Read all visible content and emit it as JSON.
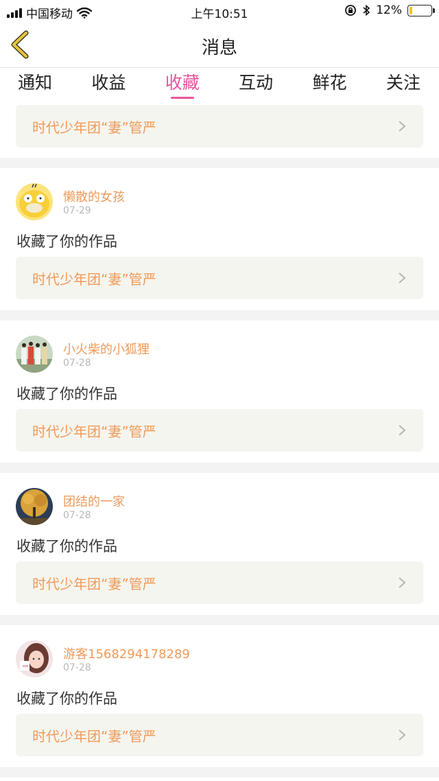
{
  "status_bar": {
    "carrier": "中国移动",
    "time": "上午10:51",
    "battery": "12%",
    "battery_level": 0.12,
    "icons": [
      "signal-icon",
      "wifi-icon",
      "rotation-lock-icon",
      "bluetooth-icon",
      "battery-icon"
    ]
  },
  "nav": {
    "title": "消息",
    "back_icon": "back-chevron-icon"
  },
  "tabs": [
    {
      "label": "通知",
      "active": false
    },
    {
      "label": "收益",
      "active": false
    },
    {
      "label": "收藏",
      "active": true
    },
    {
      "label": "互动",
      "active": false
    },
    {
      "label": "鲜花",
      "active": false
    },
    {
      "label": "关注",
      "active": false
    }
  ],
  "top_card": {
    "work_title": "时代少年团“妻”管严"
  },
  "items": [
    {
      "user": "懒散的女孩",
      "date": "07-29",
      "action": "收藏了你的作品",
      "work_title": "时代少年团“妻”管严"
    },
    {
      "user": "小火柴的小狐狸",
      "date": "07-28",
      "action": "收藏了你的作品",
      "work_title": "时代少年团“妻”管严"
    },
    {
      "user": "团结的一家",
      "date": "07-28",
      "action": "收藏了你的作品",
      "work_title": "时代少年团“妻”管严"
    },
    {
      "user": "游客1568294178289",
      "date": "07-28",
      "action": "收藏了你的作品",
      "work_title": "时代少年团“妻”管严"
    }
  ],
  "colors": {
    "accent": "#e7549b",
    "username": "#ef9a5a",
    "card_bg": "#f5f5ef",
    "back_icon": "#e8c53a"
  }
}
